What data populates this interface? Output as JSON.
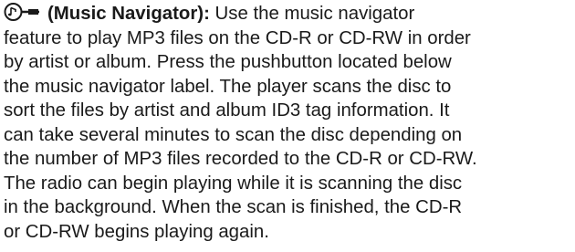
{
  "entry": {
    "icon": "music-navigator-icon",
    "term": "(Music Navigator):",
    "lines": [
      "Use the music navigator",
      "feature to play MP3 files on the CD-R or CD-RW in order",
      "by artist or album. Press the pushbutton located below",
      "the music navigator label. The player scans the disc to",
      "sort the files by artist and album ID3 tag information. It",
      "can take several minutes to scan the disc depending on",
      "the number of MP3 files recorded to the CD-R or CD-RW.",
      "The radio can begin playing while it is scanning the disc",
      "in the background. When the scan is finished, the CD-R",
      "or CD-RW begins playing again."
    ]
  }
}
